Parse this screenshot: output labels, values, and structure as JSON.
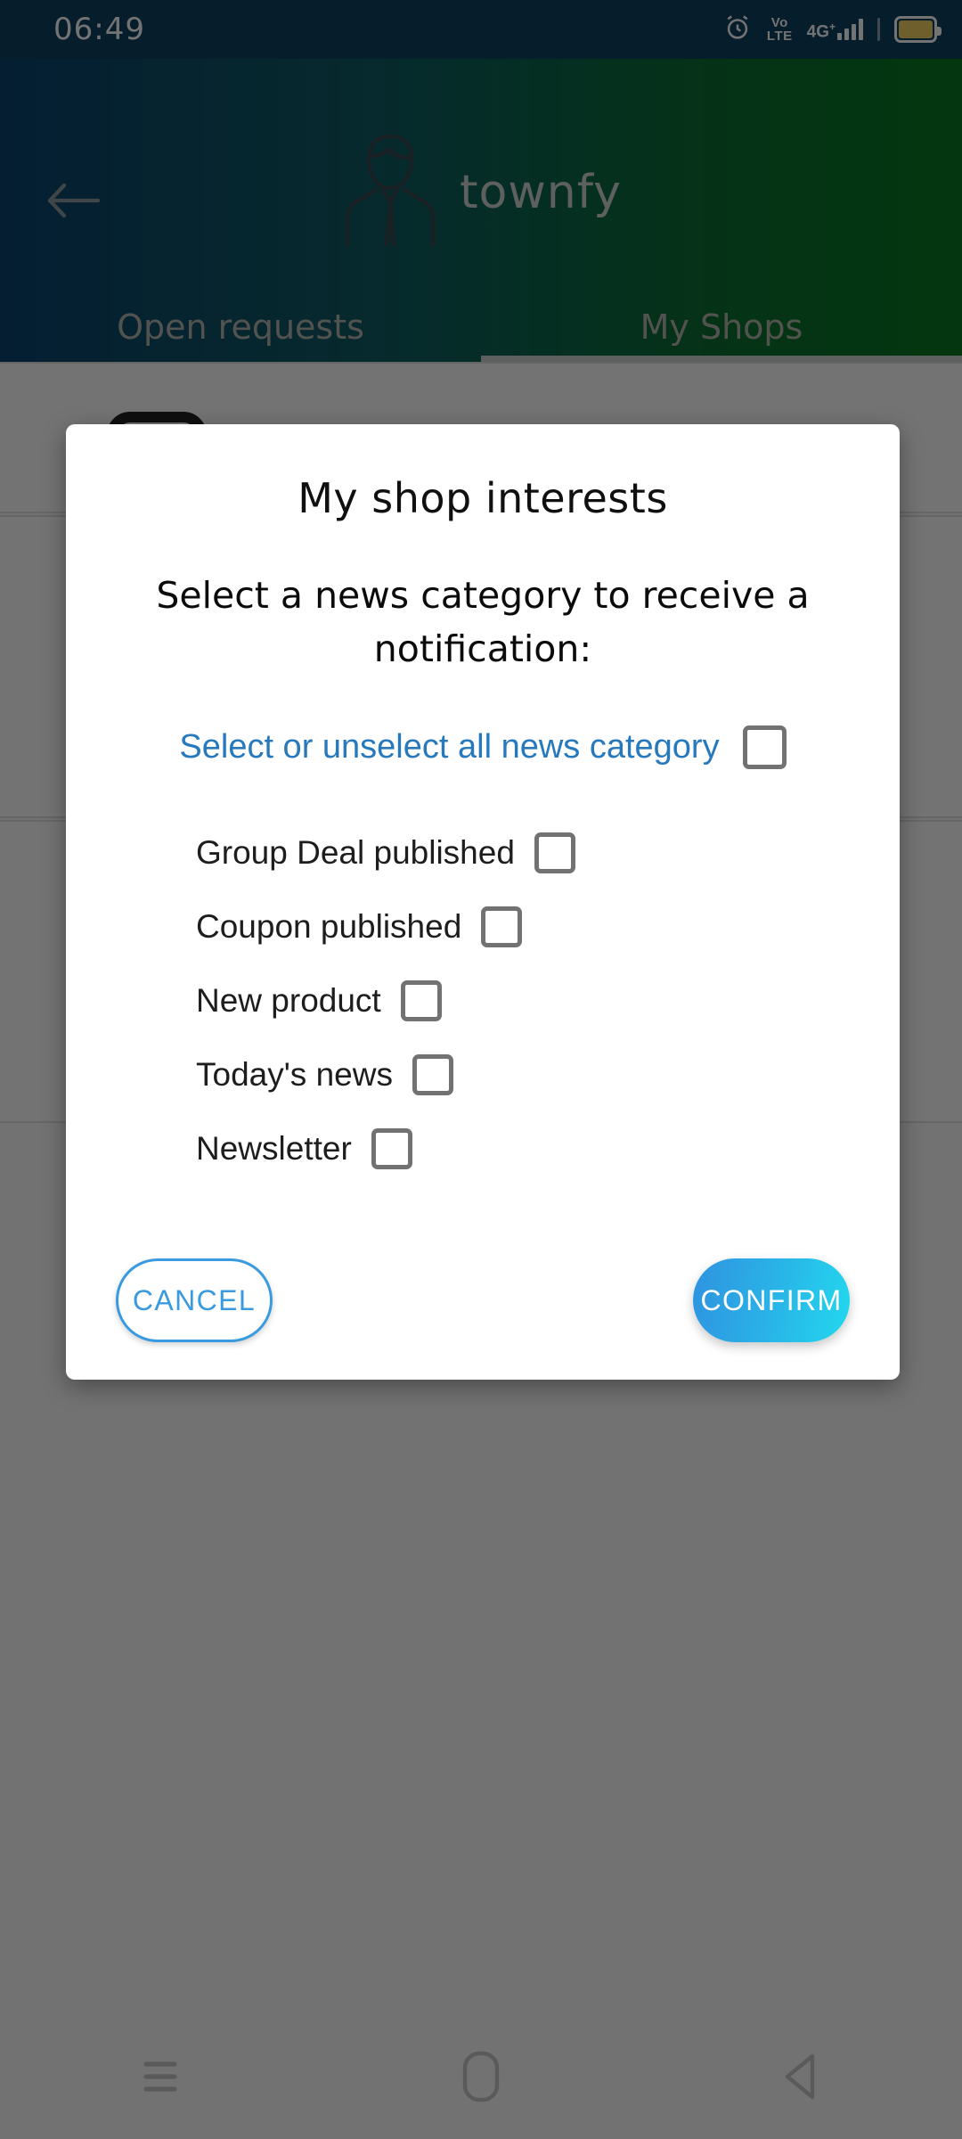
{
  "status_bar": {
    "time": "06:49",
    "icons": [
      "alarm-icon",
      "volte-icon",
      "network-4g-plus-icon",
      "battery-icon"
    ],
    "volte_top": "Vo",
    "volte_bottom": "LTE",
    "network_label": "4G",
    "network_superscript": "+",
    "background_color": "#0f4263",
    "battery_color": "#f6d365"
  },
  "app_bar": {
    "back_icon": "back-arrow-icon",
    "logo_icon": "person-avatar-icon",
    "brand_name": "townfy",
    "gradient_start": "#0d4470",
    "gradient_end": "#0a7a22"
  },
  "tabs": {
    "items": [
      {
        "label": "Open requests",
        "active": false
      },
      {
        "label": "My Shops",
        "active": true
      }
    ],
    "indicator_color": "#cfd3d0"
  },
  "dialog": {
    "title": "My shop interests",
    "subtitle": "Select a news category to receive a notification:",
    "select_all": {
      "label": "Select or unselect all news category",
      "checked": false,
      "link_color": "#2779bd"
    },
    "options": [
      {
        "label": "Group Deal published",
        "checked": false
      },
      {
        "label": "Coupon published",
        "checked": false
      },
      {
        "label": "New product",
        "checked": false
      },
      {
        "label": "Today's news",
        "checked": false
      },
      {
        "label": "Newsletter",
        "checked": false
      }
    ],
    "cancel_label": "CANCEL",
    "confirm_label": "CONFIRM",
    "cancel_color": "#3a9ae0",
    "confirm_gradient_start": "#2f93e0",
    "confirm_gradient_end": "#22d8ee"
  },
  "nav_bar": {
    "items": [
      "recents-icon",
      "home-icon",
      "back-icon"
    ]
  }
}
